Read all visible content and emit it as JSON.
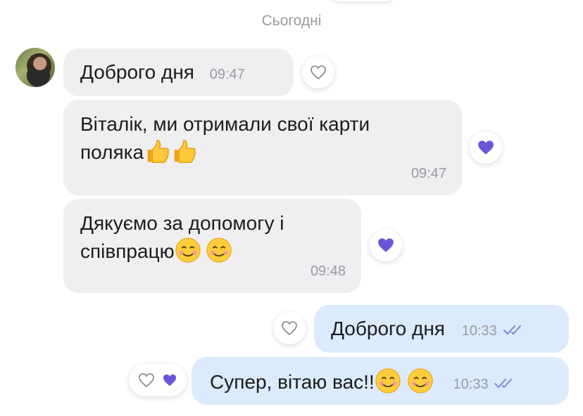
{
  "date_separator": "Сьогодні",
  "messages": [
    {
      "text": "Доброго дня",
      "time": "09:47"
    },
    {
      "text": "Віталік, ми отримали свої карти поляка",
      "line1": "Віталік, ми отримали свої карти",
      "line2": "поляка",
      "time": "09:47"
    },
    {
      "text": "Дякуємо за допомогу і співпрацю",
      "line1": "Дякуємо за допомогу і",
      "line2": "співпрацю",
      "time": "09:48"
    },
    {
      "text": "Доброго дня",
      "time": "10:33"
    },
    {
      "text": "Супер, вітаю вас!!",
      "time": "10:33"
    }
  ],
  "colors": {
    "incoming_bubble": "#efeff1",
    "outgoing_bubble": "#dbeafc",
    "accent": "#6a55d6",
    "time": "#9a9aa0"
  },
  "icons": [
    "heart-outline-icon",
    "heart-filled-icon",
    "double-check-icon",
    "thumbs-up-emoji",
    "smiling-face-emoji"
  ]
}
